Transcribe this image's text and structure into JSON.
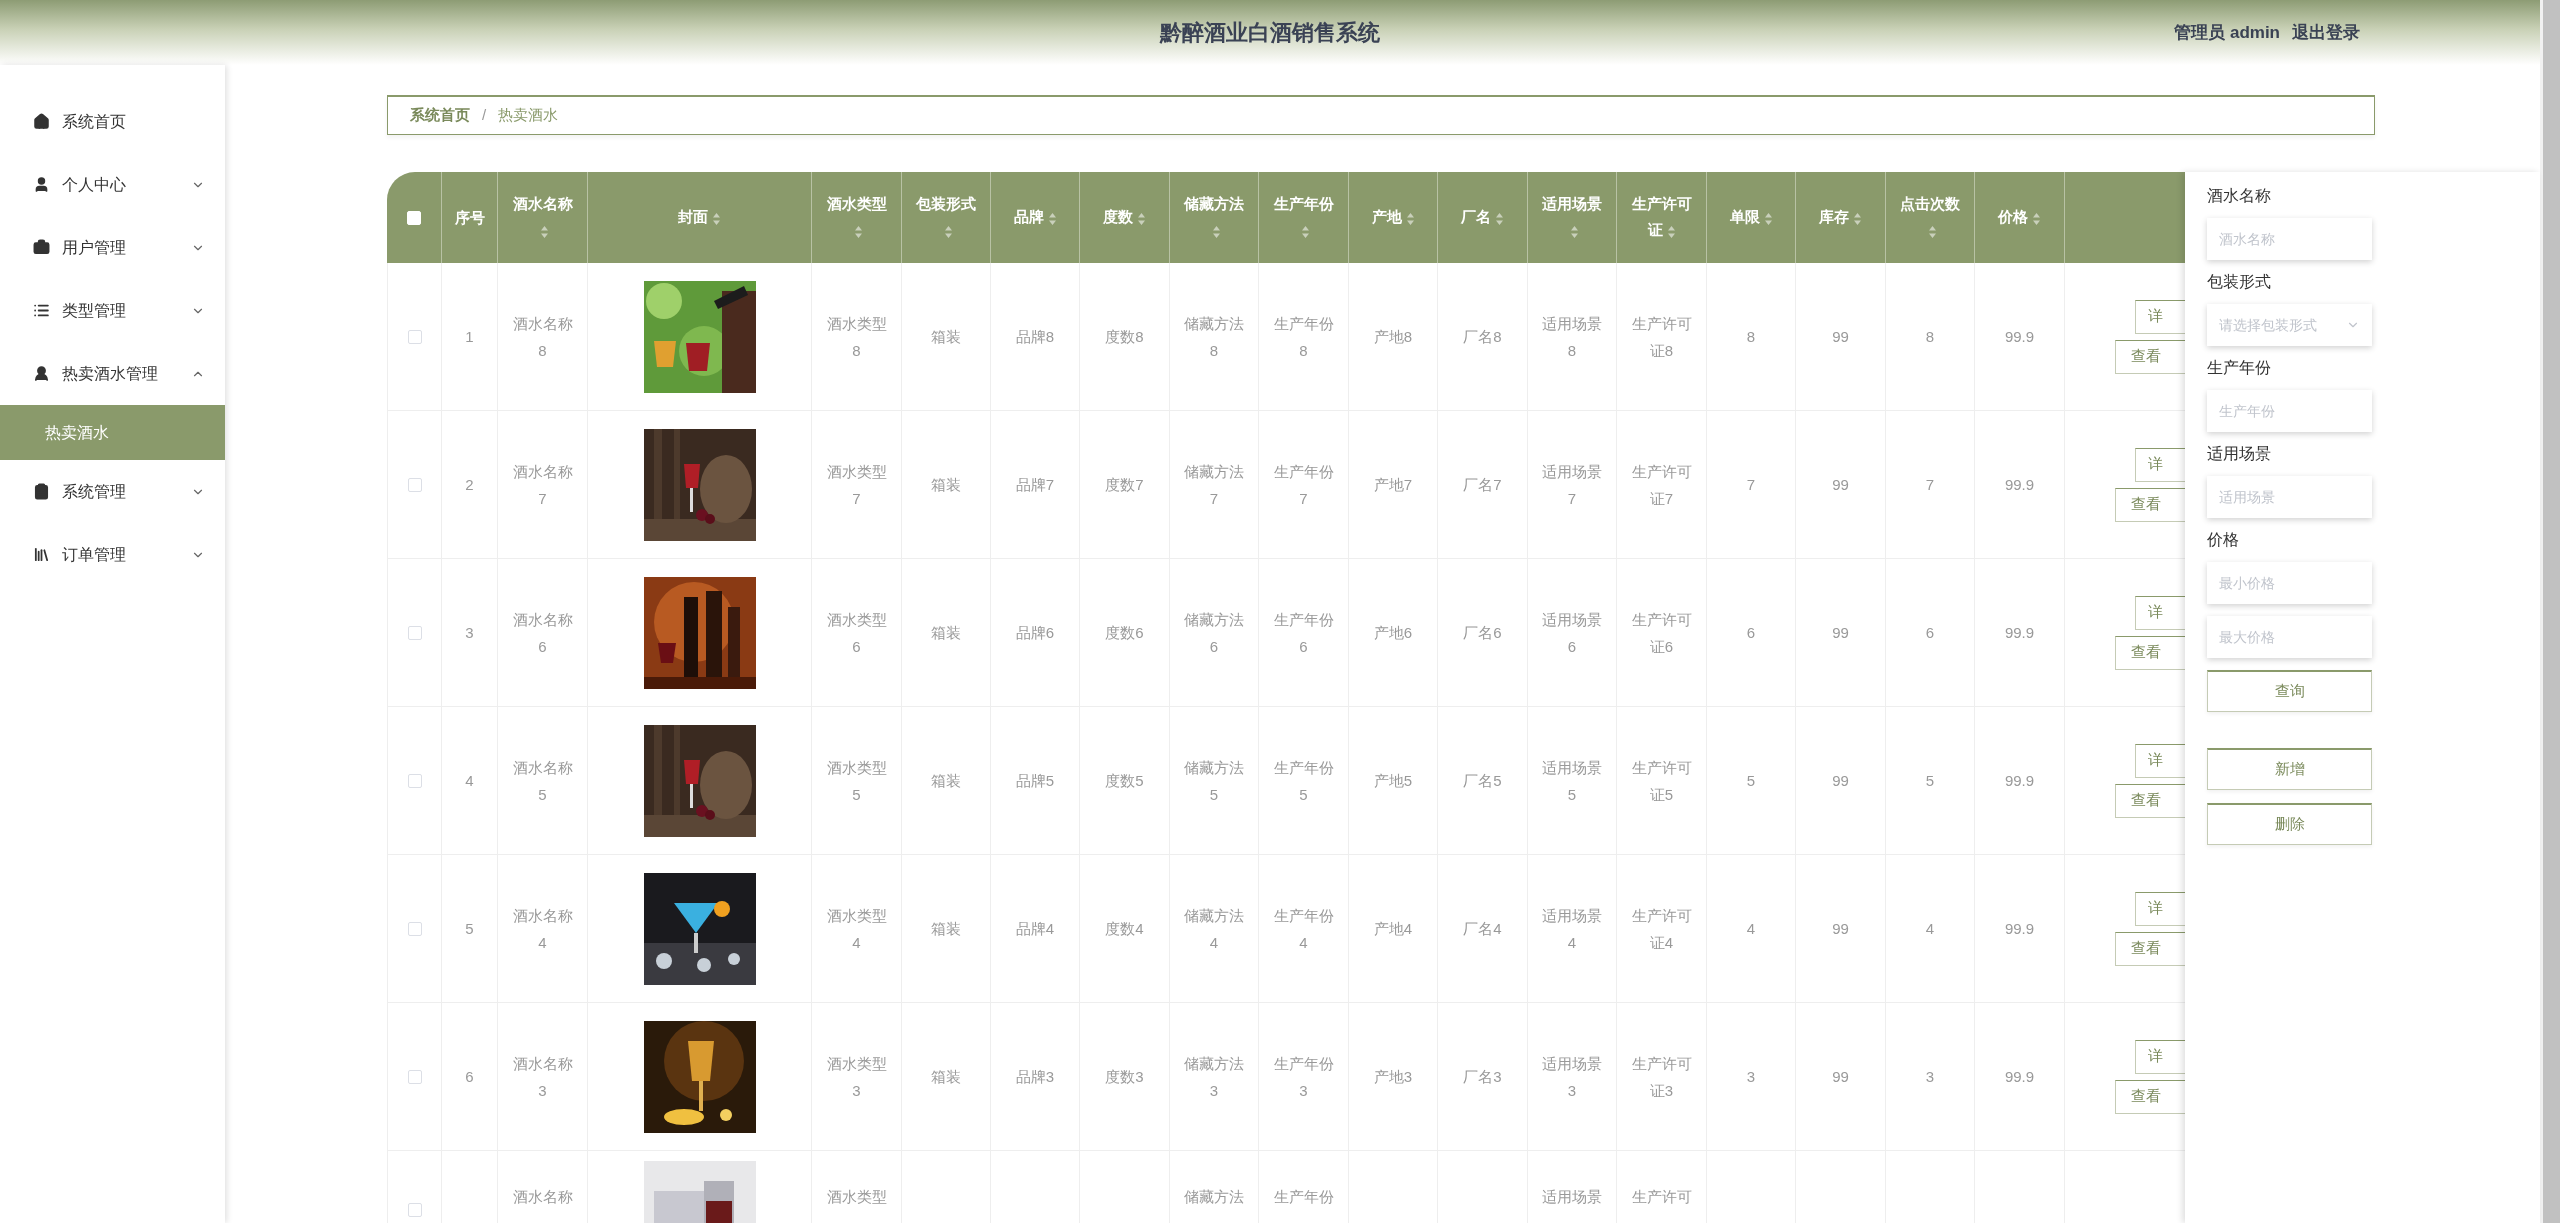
{
  "header": {
    "title": "黔醉酒业白酒销售系统",
    "user": "管理员 admin",
    "logout": "退出登录"
  },
  "sidebar": {
    "items": [
      {
        "label": "系统首页",
        "kind": "link"
      },
      {
        "label": "个人中心",
        "kind": "group",
        "expanded": false
      },
      {
        "label": "用户管理",
        "kind": "group",
        "expanded": false
      },
      {
        "label": "类型管理",
        "kind": "group",
        "expanded": false
      },
      {
        "label": "热卖酒水管理",
        "kind": "group",
        "expanded": true,
        "children": [
          {
            "label": "热卖酒水",
            "selected": true
          }
        ]
      },
      {
        "label": "系统管理",
        "kind": "group",
        "expanded": false
      },
      {
        "label": "订单管理",
        "kind": "group",
        "expanded": false
      }
    ]
  },
  "breadcrumb": {
    "items": [
      "系统首页",
      "热卖酒水"
    ],
    "separator": "/"
  },
  "table": {
    "select_all_checked": false,
    "columns": [
      {
        "label": "序号",
        "sortable": false
      },
      {
        "label": "酒水名称",
        "sortable": true
      },
      {
        "label": "封面",
        "sortable": true
      },
      {
        "label": "酒水类型",
        "sortable": true
      },
      {
        "label": "包装形式",
        "sortable": true
      },
      {
        "label": "品牌",
        "sortable": true
      },
      {
        "label": "度数",
        "sortable": true
      },
      {
        "label": "储藏方法",
        "sortable": true
      },
      {
        "label": "生产年份",
        "sortable": true
      },
      {
        "label": "产地",
        "sortable": true
      },
      {
        "label": "厂名",
        "sortable": true
      },
      {
        "label": "适用场景",
        "sortable": true
      },
      {
        "label": "生产许可证",
        "sortable": true
      },
      {
        "label": "单限",
        "sortable": true
      },
      {
        "label": "库存",
        "sortable": true
      },
      {
        "label": "点击次数",
        "sortable": true
      },
      {
        "label": "价格",
        "sortable": true
      }
    ],
    "rows": [
      {
        "checked": false,
        "cells": [
          "1",
          "酒水名称8",
          null,
          "酒水类型8",
          "箱装",
          "品牌8",
          "度数8",
          "储藏方法8",
          "生产年份8",
          "产地8",
          "厂名8",
          "适用场景8",
          "生产许可证8",
          "8",
          "99",
          "8",
          "99.9"
        ],
        "actions": [
          "详",
          "查看"
        ]
      },
      {
        "checked": false,
        "cells": [
          "2",
          "酒水名称7",
          null,
          "酒水类型7",
          "箱装",
          "品牌7",
          "度数7",
          "储藏方法7",
          "生产年份7",
          "产地7",
          "厂名7",
          "适用场景7",
          "生产许可证7",
          "7",
          "99",
          "7",
          "99.9"
        ],
        "actions": [
          "详",
          "查看"
        ]
      },
      {
        "checked": false,
        "cells": [
          "3",
          "酒水名称6",
          null,
          "酒水类型6",
          "箱装",
          "品牌6",
          "度数6",
          "储藏方法6",
          "生产年份6",
          "产地6",
          "厂名6",
          "适用场景6",
          "生产许可证6",
          "6",
          "99",
          "6",
          "99.9"
        ],
        "actions": [
          "详",
          "查看"
        ]
      },
      {
        "checked": false,
        "cells": [
          "4",
          "酒水名称5",
          null,
          "酒水类型5",
          "箱装",
          "品牌5",
          "度数5",
          "储藏方法5",
          "生产年份5",
          "产地5",
          "厂名5",
          "适用场景5",
          "生产许可证5",
          "5",
          "99",
          "5",
          "99.9"
        ],
        "actions": [
          "详",
          "查看"
        ]
      },
      {
        "checked": false,
        "cells": [
          "5",
          "酒水名称4",
          null,
          "酒水类型4",
          "箱装",
          "品牌4",
          "度数4",
          "储藏方法4",
          "生产年份4",
          "产地4",
          "厂名4",
          "适用场景4",
          "生产许可证4",
          "4",
          "99",
          "4",
          "99.9"
        ],
        "actions": [
          "详",
          "查看"
        ]
      },
      {
        "checked": false,
        "cells": [
          "6",
          "酒水名称3",
          null,
          "酒水类型3",
          "箱装",
          "品牌3",
          "度数3",
          "储藏方法3",
          "生产年份3",
          "产地3",
          "厂名3",
          "适用场景3",
          "生产许可证3",
          "3",
          "99",
          "3",
          "99.9"
        ],
        "actions": [
          "详",
          "查看"
        ]
      },
      {
        "checked": false,
        "cells": [
          null,
          "酒水名称",
          null,
          "酒水类型",
          null,
          null,
          null,
          "储藏方法",
          "生产年份",
          null,
          null,
          "适用场景",
          "生产许可",
          null,
          null,
          null,
          null
        ]
      }
    ]
  },
  "search": {
    "fields": [
      {
        "label": "酒水名称",
        "kind": "input",
        "placeholder": "酒水名称"
      },
      {
        "label": "包装形式",
        "kind": "select",
        "placeholder": "请选择包装形式"
      },
      {
        "label": "生产年份",
        "kind": "input",
        "placeholder": "生产年份"
      },
      {
        "label": "适用场景",
        "kind": "input",
        "placeholder": "适用场景"
      },
      {
        "label": "价格",
        "kind": "range",
        "placeholders": [
          "最小价格",
          "最大价格"
        ]
      }
    ],
    "query_button": "查询",
    "buttons": [
      "新增",
      "删除"
    ]
  }
}
